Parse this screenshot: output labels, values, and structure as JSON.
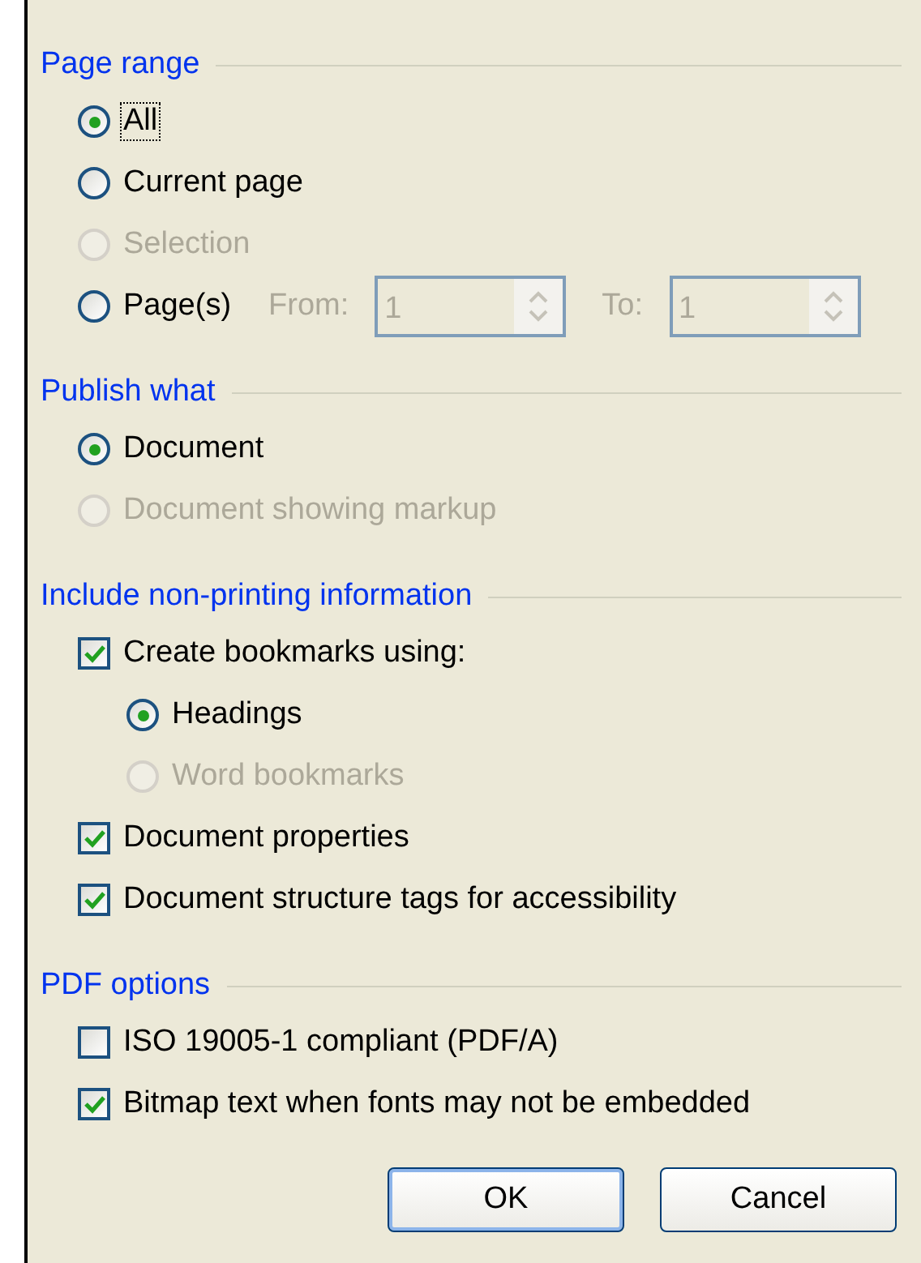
{
  "sections": [
    {
      "title": "Page range",
      "items": [
        {
          "kind": "radio",
          "label": "All",
          "selected": true,
          "disabled": false,
          "focused": true
        },
        {
          "kind": "radio",
          "label": "Current page",
          "selected": false,
          "disabled": false
        },
        {
          "kind": "radio",
          "label": "Selection",
          "selected": false,
          "disabled": true
        },
        {
          "kind": "pages",
          "label": "Page(s)",
          "selected": false,
          "disabled": false,
          "from_label": "From:",
          "from_value": "1",
          "to_label": "To:",
          "to_value": "1",
          "fields_disabled": true
        }
      ]
    },
    {
      "title": "Publish what",
      "items": [
        {
          "kind": "radio",
          "label": "Document",
          "selected": true,
          "disabled": false
        },
        {
          "kind": "radio",
          "label": "Document showing markup",
          "selected": false,
          "disabled": true
        }
      ]
    },
    {
      "title": "Include non-printing information",
      "items": [
        {
          "kind": "checkbox",
          "label": "Create bookmarks using:",
          "checked": true,
          "disabled": false,
          "children": [
            {
              "kind": "radio",
              "label": "Headings",
              "selected": true,
              "disabled": false
            },
            {
              "kind": "radio",
              "label": "Word bookmarks",
              "selected": false,
              "disabled": true
            }
          ]
        },
        {
          "kind": "checkbox",
          "label": "Document properties",
          "checked": true,
          "disabled": false
        },
        {
          "kind": "checkbox",
          "label": "Document structure tags for accessibility",
          "checked": true,
          "disabled": false
        }
      ]
    },
    {
      "title": "PDF options",
      "items": [
        {
          "kind": "checkbox",
          "label": "ISO 19005-1 compliant (PDF/A)",
          "checked": false,
          "disabled": false
        },
        {
          "kind": "checkbox",
          "label": "Bitmap text when fonts may not be embedded",
          "checked": true,
          "disabled": false
        }
      ]
    }
  ],
  "buttons": [
    "OK",
    "Cancel"
  ]
}
